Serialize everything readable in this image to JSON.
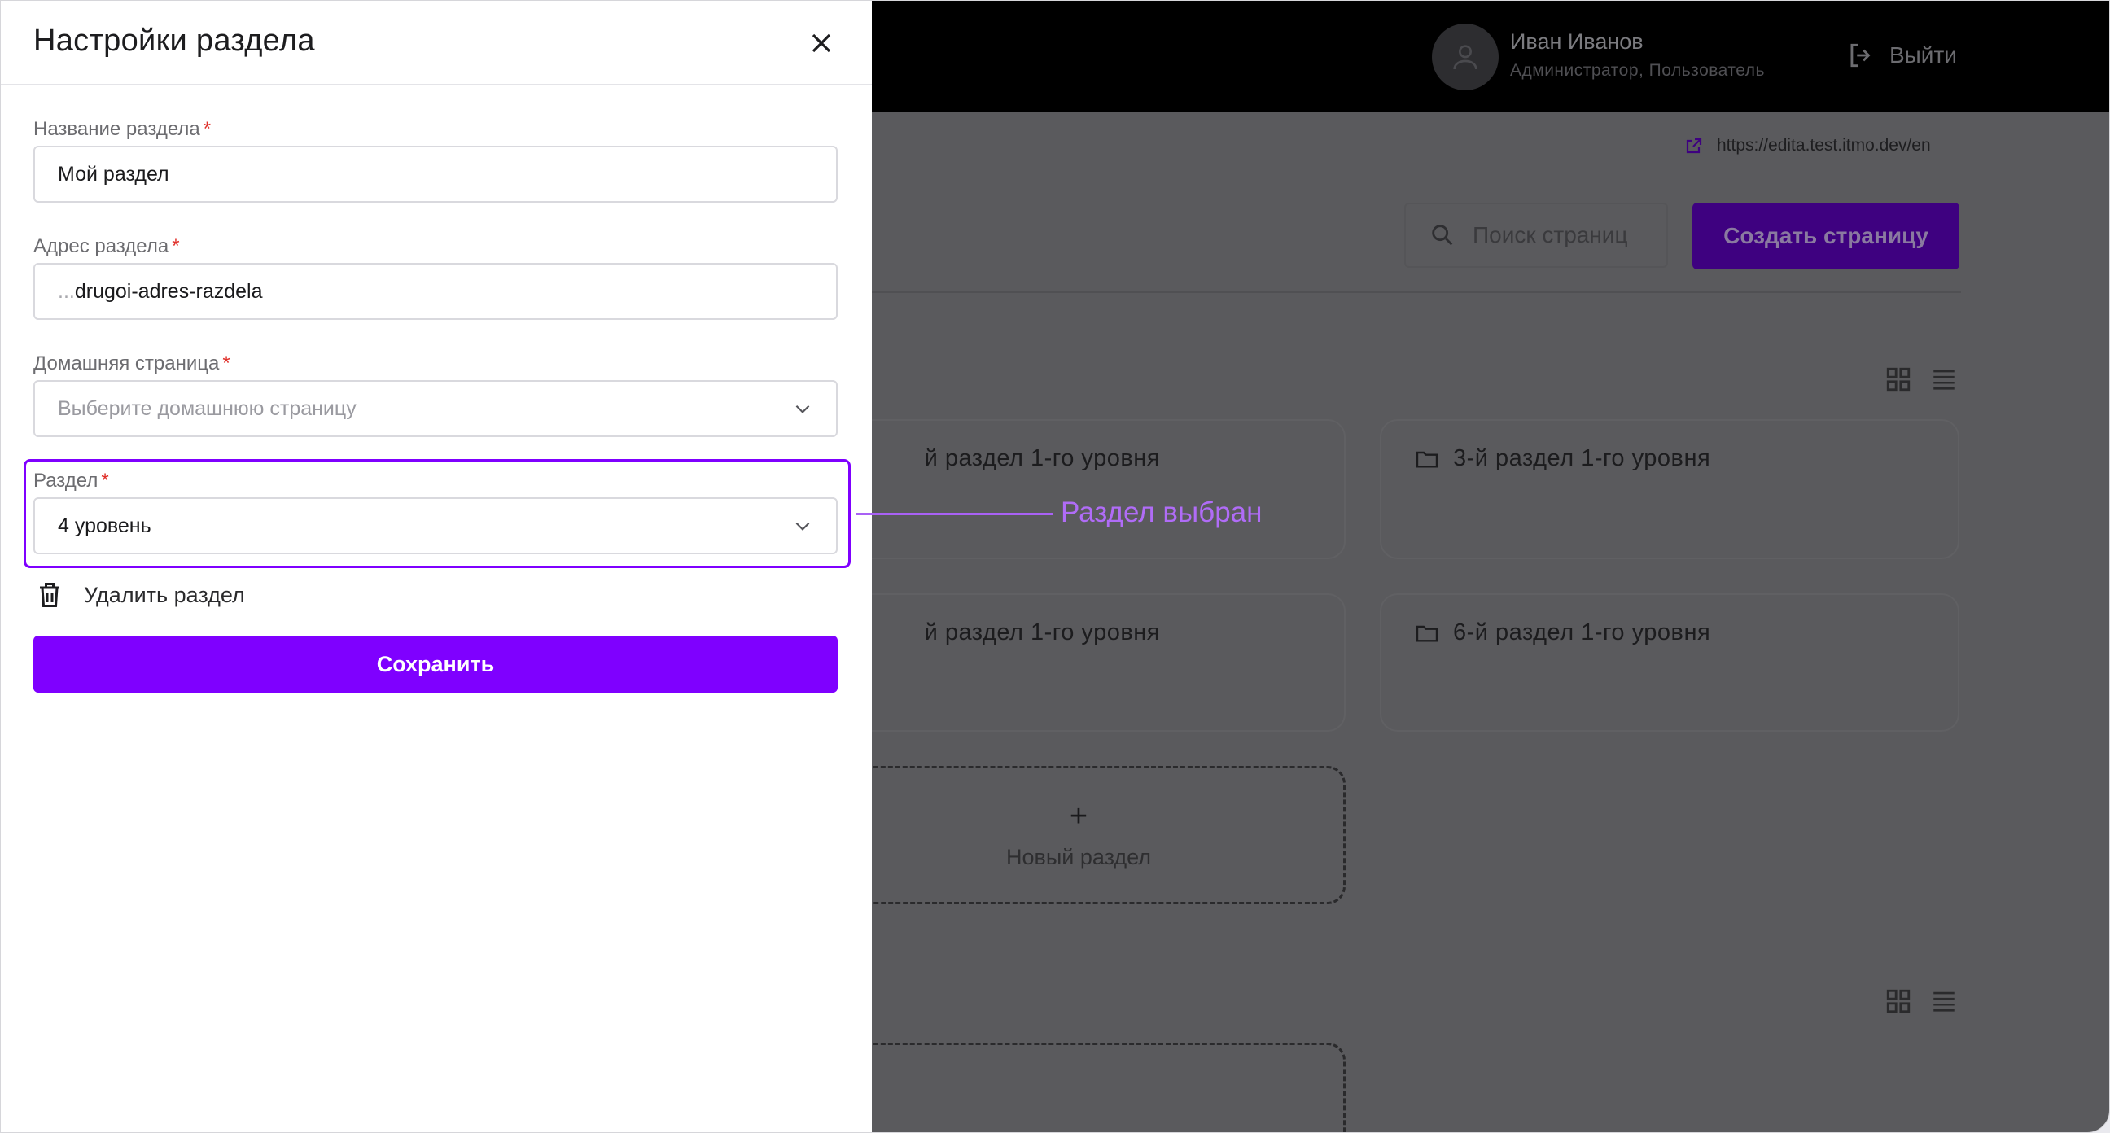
{
  "panel": {
    "title": "Настройки раздела",
    "section_name": {
      "label": "Название раздела",
      "required": "*",
      "value": "Мой раздел"
    },
    "section_address": {
      "label": "Адрес раздела",
      "required": "*",
      "prefix": "...",
      "value": "drugoi-adres-razdela"
    },
    "home_page": {
      "label": "Домашняя страница",
      "required": "*",
      "placeholder": "Выберите домашнюю страницу"
    },
    "parent_section": {
      "label": "Раздел",
      "required": "*",
      "value": "4 уровень"
    },
    "delete_label": "Удалить раздел",
    "save_label": "Сохранить"
  },
  "annotation": {
    "text": "Раздел выбран",
    "color": "#7f00ff"
  },
  "header": {
    "user_name": "Иван Иванов",
    "user_role": "Администратор, Пользователь",
    "logout_label": "Выйти"
  },
  "toolbar": {
    "site_url": "https://edita.test.itmo.dev/en",
    "search_placeholder": "Поиск страниц",
    "create_label": "Создать страницу"
  },
  "sections": [
    {
      "title": "й раздел 1-го уровня"
    },
    {
      "title": "3-й раздел 1-го уровня"
    },
    {
      "title": "й раздел 1-го уровня"
    },
    {
      "title": "6-й раздел 1-го уровня"
    }
  ],
  "new_section": {
    "plus": "+",
    "label": "Новый раздел"
  },
  "colors": {
    "accent": "#7f00ff",
    "required": "#e0302a",
    "header_bg": "#000000"
  }
}
